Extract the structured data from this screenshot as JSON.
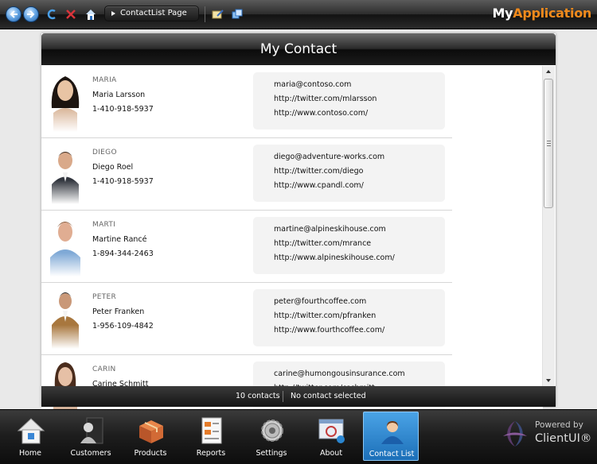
{
  "topbar": {
    "address_text": "ContactList Page",
    "brand_part1": "My",
    "brand_part2": "Application",
    "brand_color": "#f08a1c"
  },
  "panel": {
    "title": "My Contact"
  },
  "contacts": [
    {
      "nickname": "MARIA",
      "name": "Maria Larsson",
      "phone": "1-410-918-5937",
      "email": "maria@contoso.com",
      "twitter": "http://twitter.com/mlarsson",
      "website": "http://www.contoso.com/"
    },
    {
      "nickname": "DIEGO",
      "name": "Diego Roel",
      "phone": "1-410-918-5937",
      "email": "diego@adventure-works.com",
      "twitter": "http://twitter.com/diego",
      "website": "http://www.cpandl.com/"
    },
    {
      "nickname": "MARTI",
      "name": "Martine Rancé",
      "phone": "1-894-344-2463",
      "email": "martine@alpineskihouse.com",
      "twitter": "http://twitter.com/mrance",
      "website": "http://www.alpineskihouse.com/"
    },
    {
      "nickname": "PETER",
      "name": "Peter Franken",
      "phone": "1-956-109-4842",
      "email": "peter@fourthcoffee.com",
      "twitter": "http://twitter.com/pfranken",
      "website": "http://www.fourthcoffee.com/"
    },
    {
      "nickname": "CARIN",
      "name": "Carine Schmitt",
      "phone": "",
      "email": "carine@humongousinsurance.com",
      "twitter": "http://twitter.com/cschmitt",
      "website": ""
    }
  ],
  "status": {
    "count": "10 contacts",
    "selection": "No contact selected"
  },
  "dock": {
    "items": [
      {
        "label": "Home",
        "icon": "home-icon"
      },
      {
        "label": "Customers",
        "icon": "customers-icon"
      },
      {
        "label": "Products",
        "icon": "products-icon"
      },
      {
        "label": "Reports",
        "icon": "reports-icon"
      },
      {
        "label": "Settings",
        "icon": "settings-icon"
      },
      {
        "label": "About",
        "icon": "about-icon"
      },
      {
        "label": "Contact List",
        "icon": "contact-list-icon",
        "active": true
      }
    ],
    "active_color": "#2a86d1"
  },
  "powered_by": {
    "line1": "Powered by",
    "line2": "ClientUI®"
  }
}
